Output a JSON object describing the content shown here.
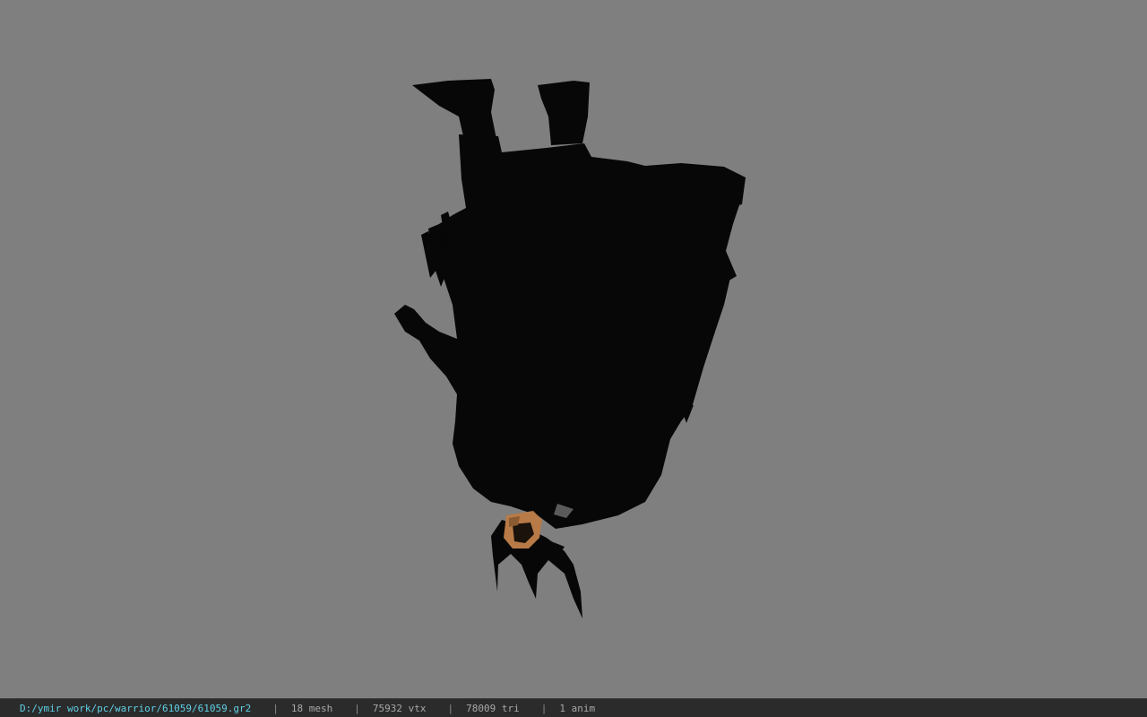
{
  "viewport": {
    "background": "#7f7f7f",
    "model_silhouette_color": "#070707",
    "skin_color": "#b87a46"
  },
  "status_bar": {
    "file_path": "D:/ymir work/pc/warrior/61059/61059.gr2",
    "separator": "|",
    "mesh_count": "18 mesh",
    "vertex_count": "75932 vtx",
    "triangle_count": "78009 tri",
    "anim_count": "1 anim",
    "path_color": "#5fd0e6"
  }
}
